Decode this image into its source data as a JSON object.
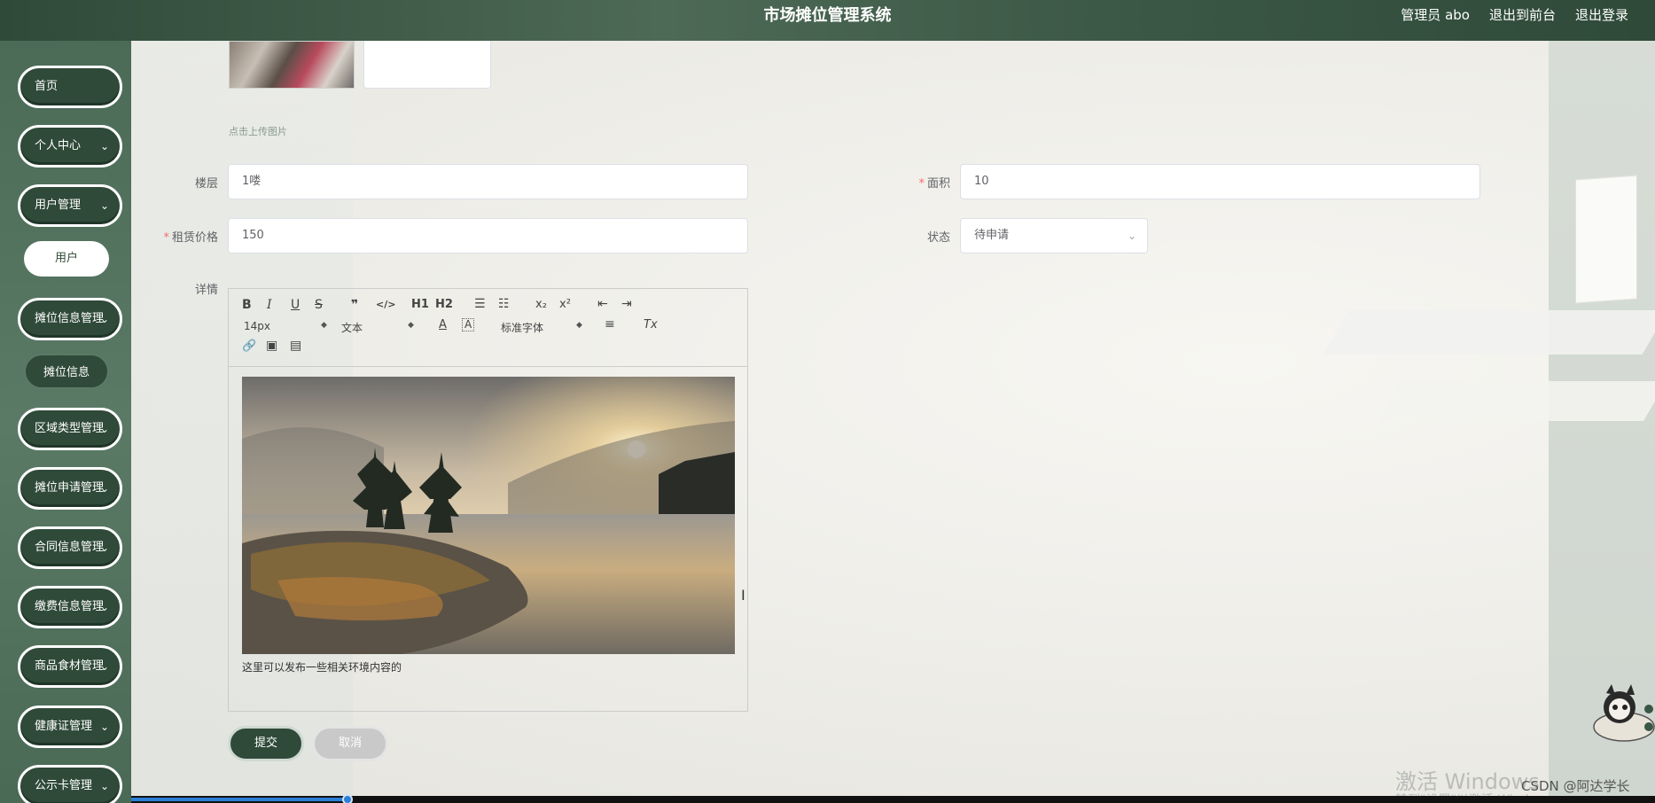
{
  "header": {
    "title": "市场摊位管理系统",
    "user_label": "管理员 abo",
    "to_front_label": "退出到前台",
    "logout_label": "退出登录"
  },
  "sidebar": {
    "items": [
      {
        "label": "首页",
        "chevron": ""
      },
      {
        "label": "个人中心",
        "chevron": "⌄"
      },
      {
        "label": "用户管理",
        "chevron": "⌄"
      },
      {
        "label": "用户",
        "sub": true
      },
      {
        "label": "摊位信息管理",
        "chevron": "⌄"
      },
      {
        "label": "摊位信息",
        "sub": true
      },
      {
        "label": "区域类型管理",
        "chevron": "⌄"
      },
      {
        "label": "摊位申请管理",
        "chevron": "⌄"
      },
      {
        "label": "合同信息管理",
        "chevron": "⌄"
      },
      {
        "label": "缴费信息管理",
        "chevron": "⌄"
      },
      {
        "label": "商品食材管理",
        "chevron": "⌄"
      },
      {
        "label": "健康证管理",
        "chevron": "⌄"
      },
      {
        "label": "公示卡管理",
        "chevron": "⌄"
      }
    ]
  },
  "form": {
    "upload_hint": "点击上传图片",
    "floor": {
      "label": "楼层",
      "value": "1喽"
    },
    "area": {
      "label": "面积",
      "value": "10",
      "required": "*"
    },
    "price": {
      "label": "租赁价格",
      "value": "150",
      "required": "*"
    },
    "status": {
      "label": "状态",
      "value": "待申请"
    },
    "detail": {
      "label": "详情"
    }
  },
  "editor": {
    "toolbar": {
      "bold": "B",
      "italic": "I",
      "underline": "U",
      "strike": "S",
      "quote": "❞",
      "code": "</>",
      "h1": "H1",
      "h2": "H2",
      "ordered_list": "☰",
      "bullet_list": "☷",
      "subscript": "x₂",
      "superscript": "x²",
      "outdent": "⇤",
      "indent": "⇥",
      "font_size": "14px",
      "header_select": "文本",
      "color": "A",
      "background": "A",
      "font_family": "标准字体",
      "align": "≡",
      "clean": "Tx",
      "link": "🔗",
      "image": "▣",
      "video": "▤"
    },
    "caption": "这里可以发布一些相关环境内容的"
  },
  "buttons": {
    "submit": "提交",
    "cancel": "取消"
  },
  "overlays": {
    "windows_watermark": "激活 Windows",
    "windows_watermark_sub": "转到\"设置\"以激活 Windows。",
    "csdn": "CSDN @阿达学长",
    "video_progress": 0.21
  },
  "colors": {
    "primary": "#2f4a38",
    "sidebar": "#5a7a66",
    "required": "#f56c6c",
    "progress": "#2b7fd6"
  }
}
